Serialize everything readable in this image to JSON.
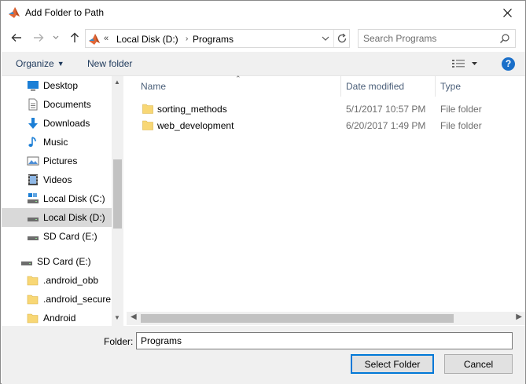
{
  "window": {
    "title": "Add Folder to Path"
  },
  "address": {
    "overflow": "«",
    "segments": [
      "Local Disk (D:)",
      "Programs"
    ]
  },
  "search": {
    "placeholder": "Search Programs"
  },
  "toolbar": {
    "organize_label": "Organize",
    "new_folder_label": "New folder"
  },
  "sidebar": {
    "items": [
      {
        "label": "Desktop",
        "icon": "desktop-icon"
      },
      {
        "label": "Documents",
        "icon": "documents-icon"
      },
      {
        "label": "Downloads",
        "icon": "downloads-icon"
      },
      {
        "label": "Music",
        "icon": "music-icon"
      },
      {
        "label": "Pictures",
        "icon": "pictures-icon"
      },
      {
        "label": "Videos",
        "icon": "videos-icon"
      },
      {
        "label": "Local Disk (C:)",
        "icon": "drive-icon"
      },
      {
        "label": "Local Disk (D:)",
        "icon": "drive-icon",
        "selected": true
      },
      {
        "label": "SD Card (E:)",
        "icon": "drive-icon"
      },
      {
        "label": "SD Card (E:)",
        "icon": "drive-icon"
      },
      {
        "label": ".android_obb",
        "icon": "folder-icon"
      },
      {
        "label": ".android_secure",
        "icon": "folder-icon"
      },
      {
        "label": "Android",
        "icon": "folder-icon"
      }
    ]
  },
  "filelist": {
    "columns": {
      "name": "Name",
      "date": "Date modified",
      "type": "Type"
    },
    "rows": [
      {
        "name": "sorting_methods",
        "date": "5/1/2017 10:57 PM",
        "type": "File folder"
      },
      {
        "name": "web_development",
        "date": "6/20/2017 1:49 PM",
        "type": "File folder"
      }
    ]
  },
  "bottom": {
    "folder_label": "Folder:",
    "folder_value": "Programs",
    "select_label": "Select Folder",
    "cancel_label": "Cancel"
  },
  "colors": {
    "accent": "#0078d7",
    "selected_bg": "#d9d9d9",
    "folder": "#f8d775",
    "link": "#1e395b"
  }
}
